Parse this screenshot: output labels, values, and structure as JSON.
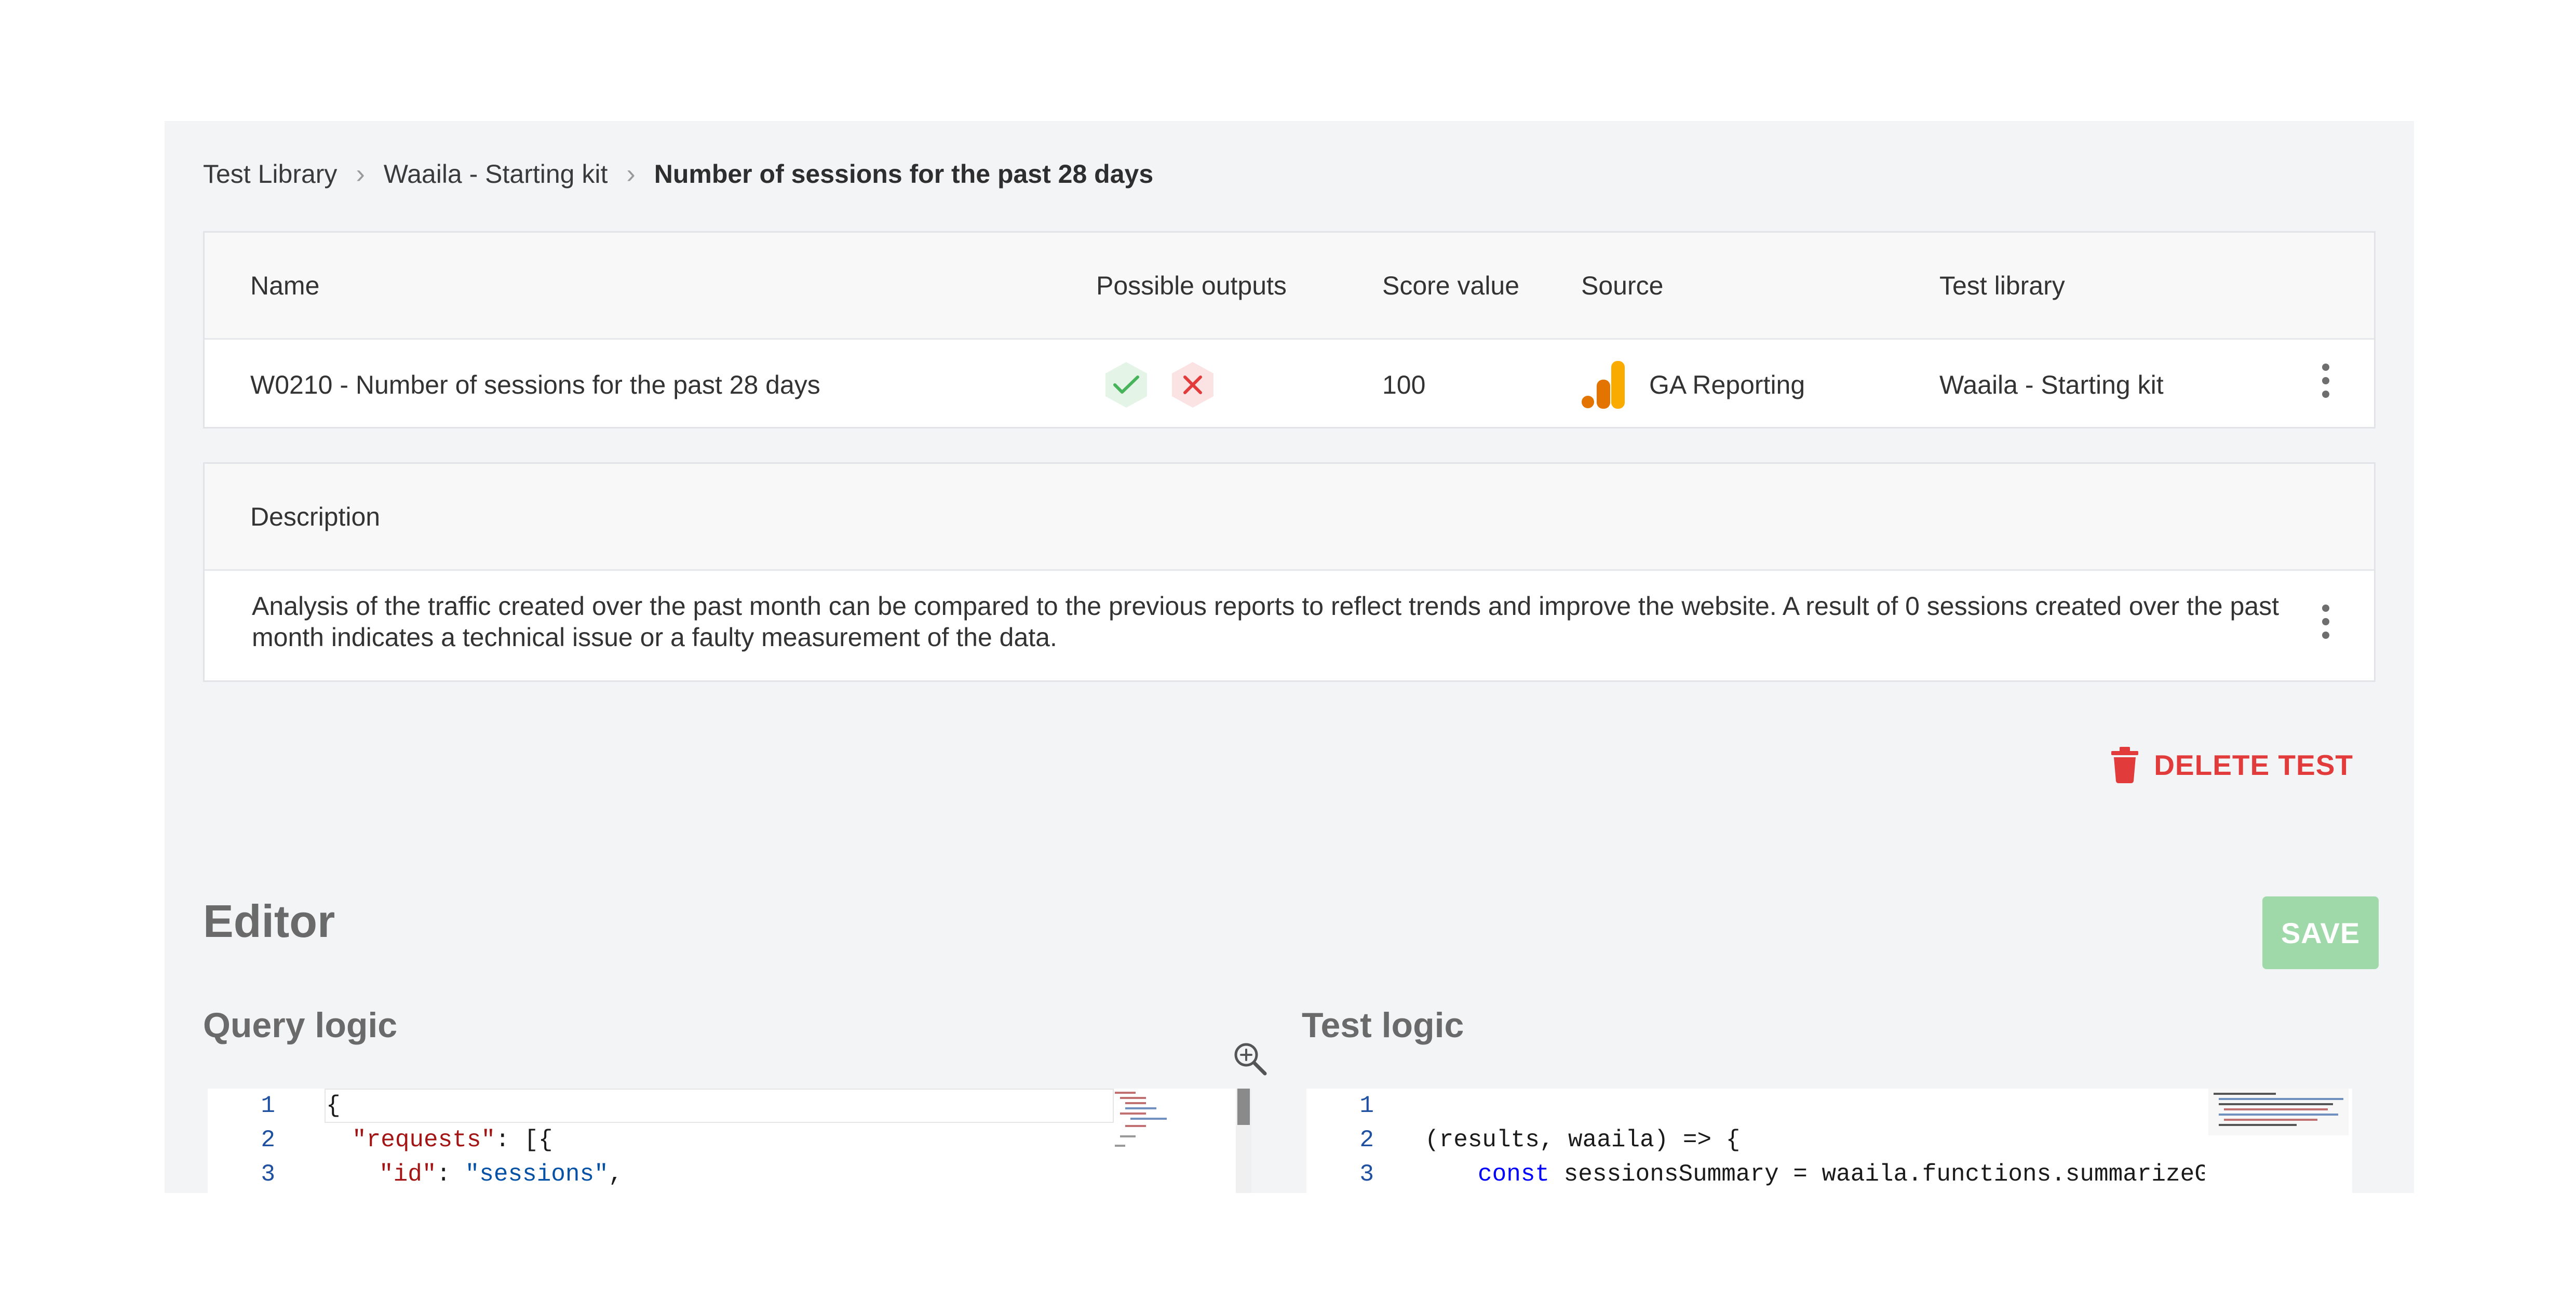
{
  "breadcrumb": {
    "items": [
      "Test Library",
      "Waaila - Starting kit"
    ],
    "current": "Number of sessions for the past 28 days",
    "separator": "›"
  },
  "test_table": {
    "headers": {
      "name": "Name",
      "outputs": "Possible outputs",
      "score": "Score value",
      "source": "Source",
      "library": "Test library"
    },
    "row": {
      "name": "W0210 - Number of sessions for the past 28 days",
      "outputs": [
        "check-icon",
        "cross-icon"
      ],
      "score": "100",
      "source": "GA Reporting",
      "library": "Waaila - Starting kit"
    }
  },
  "description": {
    "header": "Description",
    "text": "Analysis of the traffic created over the past month can be compared to the previous reports to reflect trends and improve the website. A result of 0 sessions created over the past month indicates a technical issue or a faulty measurement of the data."
  },
  "actions": {
    "delete_label": "DELETE TEST",
    "save_label": "SAVE"
  },
  "editor": {
    "title": "Editor",
    "query_title": "Query logic",
    "test_title": "Test logic",
    "query_lines": [
      {
        "n": "1",
        "text": "{"
      },
      {
        "n": "2",
        "key": "\"requests\"",
        "rest": ": [{"
      },
      {
        "n": "3",
        "key": "\"id\"",
        "mid": ": ",
        "str": "\"sessions\"",
        "tail": ","
      }
    ],
    "test_lines": [
      {
        "n": "1",
        "text": ""
      },
      {
        "n": "2",
        "text": "(results, waaila) => {"
      },
      {
        "n": "3",
        "kw": "const",
        "rest": " sessionsSummary = waaila.functions.summarizeGaR"
      }
    ]
  },
  "colors": {
    "accent_red": "#e23b3b",
    "save_green": "#9fd8a9",
    "ga_orange": "#f9ab00",
    "ga_dark_orange": "#e37400"
  }
}
